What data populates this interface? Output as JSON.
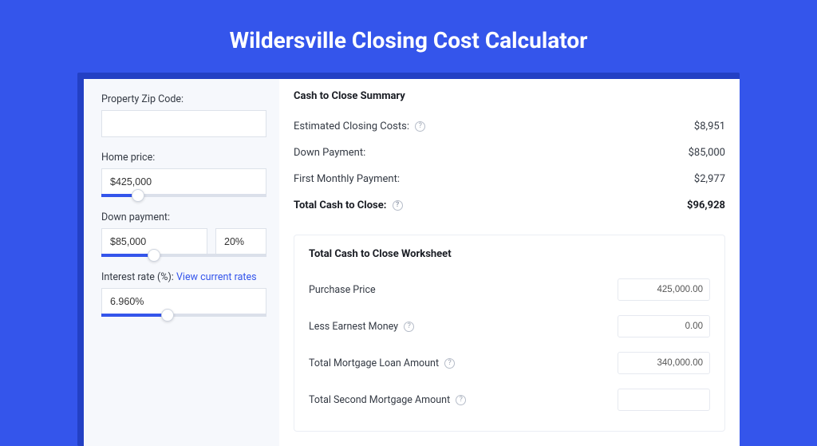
{
  "title": "Wildersville Closing Cost Calculator",
  "form": {
    "zip_label": "Property Zip Code:",
    "zip_value": "",
    "price_label": "Home price:",
    "price_value": "$425,000",
    "price_slider_pct": 22,
    "down_label": "Down payment:",
    "down_value": "$85,000",
    "down_pct": "20%",
    "down_slider_pct": 32,
    "rate_label": "Interest rate (%):",
    "rate_link": "View current rates",
    "rate_value": "6.960%",
    "rate_slider_pct": 40
  },
  "summary": {
    "title": "Cash to Close Summary",
    "rows": [
      {
        "label": "Estimated Closing Costs:",
        "help": true,
        "value": "$8,951"
      },
      {
        "label": "Down Payment:",
        "help": false,
        "value": "$85,000"
      },
      {
        "label": "First Monthly Payment:",
        "help": false,
        "value": "$2,977"
      }
    ],
    "total_label": "Total Cash to Close:",
    "total_value": "$96,928"
  },
  "worksheet": {
    "title": "Total Cash to Close Worksheet",
    "rows": [
      {
        "label": "Purchase Price",
        "help": false,
        "value": "425,000.00"
      },
      {
        "label": "Less Earnest Money",
        "help": true,
        "value": "0.00"
      },
      {
        "label": "Total Mortgage Loan Amount",
        "help": true,
        "value": "340,000.00"
      },
      {
        "label": "Total Second Mortgage Amount",
        "help": true,
        "value": ""
      }
    ]
  }
}
